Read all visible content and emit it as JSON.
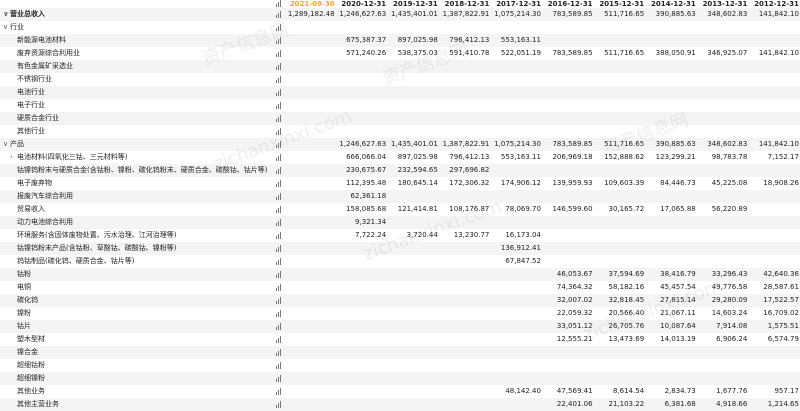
{
  "years": [
    "2021-09-30",
    "2020-12-31",
    "2019-12-31",
    "2018-12-31",
    "2017-12-31",
    "2016-12-31",
    "2015-12-31",
    "2014-12-31",
    "2013-12-31",
    "2012-12-31"
  ],
  "rows": [
    {
      "label": "营业总收入",
      "level": 0,
      "bold": true,
      "caret": "down",
      "values": [
        "1,289,182.48",
        "1,246,627.63",
        "1,435,401.01",
        "1,387,822.91",
        "1,075,214.30",
        "783,589.85",
        "511,716.65",
        "390,885.63",
        "348,602.83",
        "141,842.10"
      ]
    },
    {
      "label": "行业",
      "level": 0,
      "caret": "down",
      "values": [
        "",
        "",
        "",
        "",
        "",
        "",
        "",
        "",
        "",
        ""
      ]
    },
    {
      "label": "新能源电池材料",
      "level": 1,
      "values": [
        "",
        "675,387.37",
        "897,025.98",
        "796,412.13",
        "553,163.11",
        "",
        "",
        "",
        "",
        ""
      ]
    },
    {
      "label": "废弃资源综合利用业",
      "level": 1,
      "values": [
        "",
        "571,240.26",
        "538,375.03",
        "591,410.78",
        "522,051.19",
        "783,589.85",
        "511,716.65",
        "388,050.91",
        "346,925.07",
        "141,842.10"
      ]
    },
    {
      "label": "有色金属矿采选业",
      "level": 1,
      "values": [
        "",
        "",
        "",
        "",
        "",
        "",
        "",
        "",
        "",
        ""
      ]
    },
    {
      "label": "不锈钢行业",
      "level": 1,
      "values": [
        "",
        "",
        "",
        "",
        "",
        "",
        "",
        "",
        "",
        ""
      ]
    },
    {
      "label": "电池行业",
      "level": 1,
      "values": [
        "",
        "",
        "",
        "",
        "",
        "",
        "",
        "",
        "",
        ""
      ]
    },
    {
      "label": "电子行业",
      "level": 1,
      "values": [
        "",
        "",
        "",
        "",
        "",
        "",
        "",
        "",
        "",
        ""
      ]
    },
    {
      "label": "硬质合金行业",
      "level": 1,
      "values": [
        "",
        "",
        "",
        "",
        "",
        "",
        "",
        "",
        "",
        ""
      ]
    },
    {
      "label": "其他行业",
      "level": 1,
      "values": [
        "",
        "",
        "",
        "",
        "",
        "",
        "",
        "",
        "",
        ""
      ]
    },
    {
      "label": "产品",
      "level": 0,
      "caret": "down",
      "values": [
        "",
        "1,246,627.63",
        "1,435,401.01",
        "1,387,822.91",
        "1,075,214.30",
        "783,589.85",
        "511,716.65",
        "390,885.63",
        "348,602.83",
        "141,842.10"
      ]
    },
    {
      "label": "电池材料(四氧化三钴、三元材料等)",
      "level": 1,
      "caret": "right",
      "values": [
        "",
        "666,066.04",
        "897,025.98",
        "796,412.13",
        "553,163.11",
        "206,969.18",
        "152,888.62",
        "123,299.21",
        "98,783.78",
        "7,152.17"
      ]
    },
    {
      "label": "钴镍钨粉末与硬质合金(含钴粉、镍粉、碳化钨粉末、硬质合金、碳酸钴、钴片等)",
      "level": 1,
      "values": [
        "",
        "230,675.67",
        "232,594.65",
        "297,696.82",
        "",
        "",
        "",
        "",
        "",
        ""
      ]
    },
    {
      "label": "电子废弃物",
      "level": 1,
      "values": [
        "",
        "112,395.48",
        "180,645.14",
        "172,306.32",
        "174,906.12",
        "139,959.93",
        "109,603.39",
        "84,446.73",
        "45,225.08",
        "18,908.26"
      ]
    },
    {
      "label": "报废汽车综合利用",
      "level": 1,
      "values": [
        "",
        "62,361.18",
        "",
        "",
        "",
        "",
        "",
        "",
        "",
        ""
      ]
    },
    {
      "label": "贸易收入",
      "level": 1,
      "values": [
        "",
        "158,085.68",
        "121,414.81",
        "108,176.87",
        "78,069.70",
        "146,599.60",
        "30,165.72",
        "17,065.88",
        "56,220.89",
        ""
      ]
    },
    {
      "label": "动力电池综合利用",
      "level": 1,
      "values": [
        "",
        "9,321.34",
        "",
        "",
        "",
        "",
        "",
        "",
        "",
        ""
      ]
    },
    {
      "label": "环境服务(含固体废物处置、污水治理、江河治理等)",
      "level": 1,
      "values": [
        "",
        "7,722.24",
        "3,720.44",
        "13,230.77",
        "16,173.04",
        "",
        "",
        "",
        "",
        ""
      ]
    },
    {
      "label": "钴镍钨粉末产品(含钴粉、草酸钴、碳酸钴、镍粉等)",
      "level": 1,
      "values": [
        "",
        "",
        "",
        "",
        "136,912.41",
        "",
        "",
        "",
        "",
        ""
      ]
    },
    {
      "label": "钨钴制品(碳化钨、硬质合金、钴片等)",
      "level": 1,
      "values": [
        "",
        "",
        "",
        "",
        "67,847.52",
        "",
        "",
        "",
        "",
        ""
      ]
    },
    {
      "label": "钴粉",
      "level": 1,
      "values": [
        "",
        "",
        "",
        "",
        "",
        "46,053.67",
        "37,594.69",
        "38,416.79",
        "33,296.43",
        "42,640.36"
      ]
    },
    {
      "label": "电铜",
      "level": 1,
      "values": [
        "",
        "",
        "",
        "",
        "",
        "74,364.32",
        "58,182.16",
        "45,457.54",
        "49,776.58",
        "28,587.61"
      ]
    },
    {
      "label": "碳化钨",
      "level": 1,
      "values": [
        "",
        "",
        "",
        "",
        "",
        "32,007.02",
        "32,818.45",
        "27,815.14",
        "29,280.09",
        "17,522.57"
      ]
    },
    {
      "label": "镍粉",
      "level": 1,
      "values": [
        "",
        "",
        "",
        "",
        "",
        "22,059.32",
        "20,566.40",
        "21,067.11",
        "14,603.24",
        "16,709.02"
      ]
    },
    {
      "label": "钴片",
      "level": 1,
      "values": [
        "",
        "",
        "",
        "",
        "",
        "33,051.12",
        "26,705.76",
        "10,087.64",
        "7,914.08",
        "1,575.51"
      ]
    },
    {
      "label": "塑木型材",
      "level": 1,
      "values": [
        "",
        "",
        "",
        "",
        "",
        "12,555.21",
        "13,473.69",
        "14,013.19",
        "6,906.24",
        "6,574.79"
      ]
    },
    {
      "label": "镍合金",
      "level": 1,
      "values": [
        "",
        "",
        "",
        "",
        "",
        "",
        "",
        "",
        "",
        ""
      ]
    },
    {
      "label": "超细钴粉",
      "level": 1,
      "values": [
        "",
        "",
        "",
        "",
        "",
        "",
        "",
        "",
        "",
        ""
      ]
    },
    {
      "label": "超细镍粉",
      "level": 1,
      "values": [
        "",
        "",
        "",
        "",
        "",
        "",
        "",
        "",
        "",
        ""
      ]
    },
    {
      "label": "其他业务",
      "level": 1,
      "values": [
        "",
        "",
        "",
        "",
        "48,142.40",
        "47,569.41",
        "8,614.54",
        "2,834.73",
        "1,677.76",
        "957.17"
      ]
    },
    {
      "label": "其他主营业务",
      "level": 1,
      "values": [
        "",
        "",
        "",
        "",
        "",
        "22,401.06",
        "21,103.22",
        "6,381.68",
        "4,918.66",
        "1,214.65"
      ]
    }
  ],
  "watermarks": [
    "资产信息网",
    "zichanxinxi.com",
    "资产信息网",
    "zichanxinxi.com",
    "资产信息网",
    "zichanxinxi.com"
  ]
}
